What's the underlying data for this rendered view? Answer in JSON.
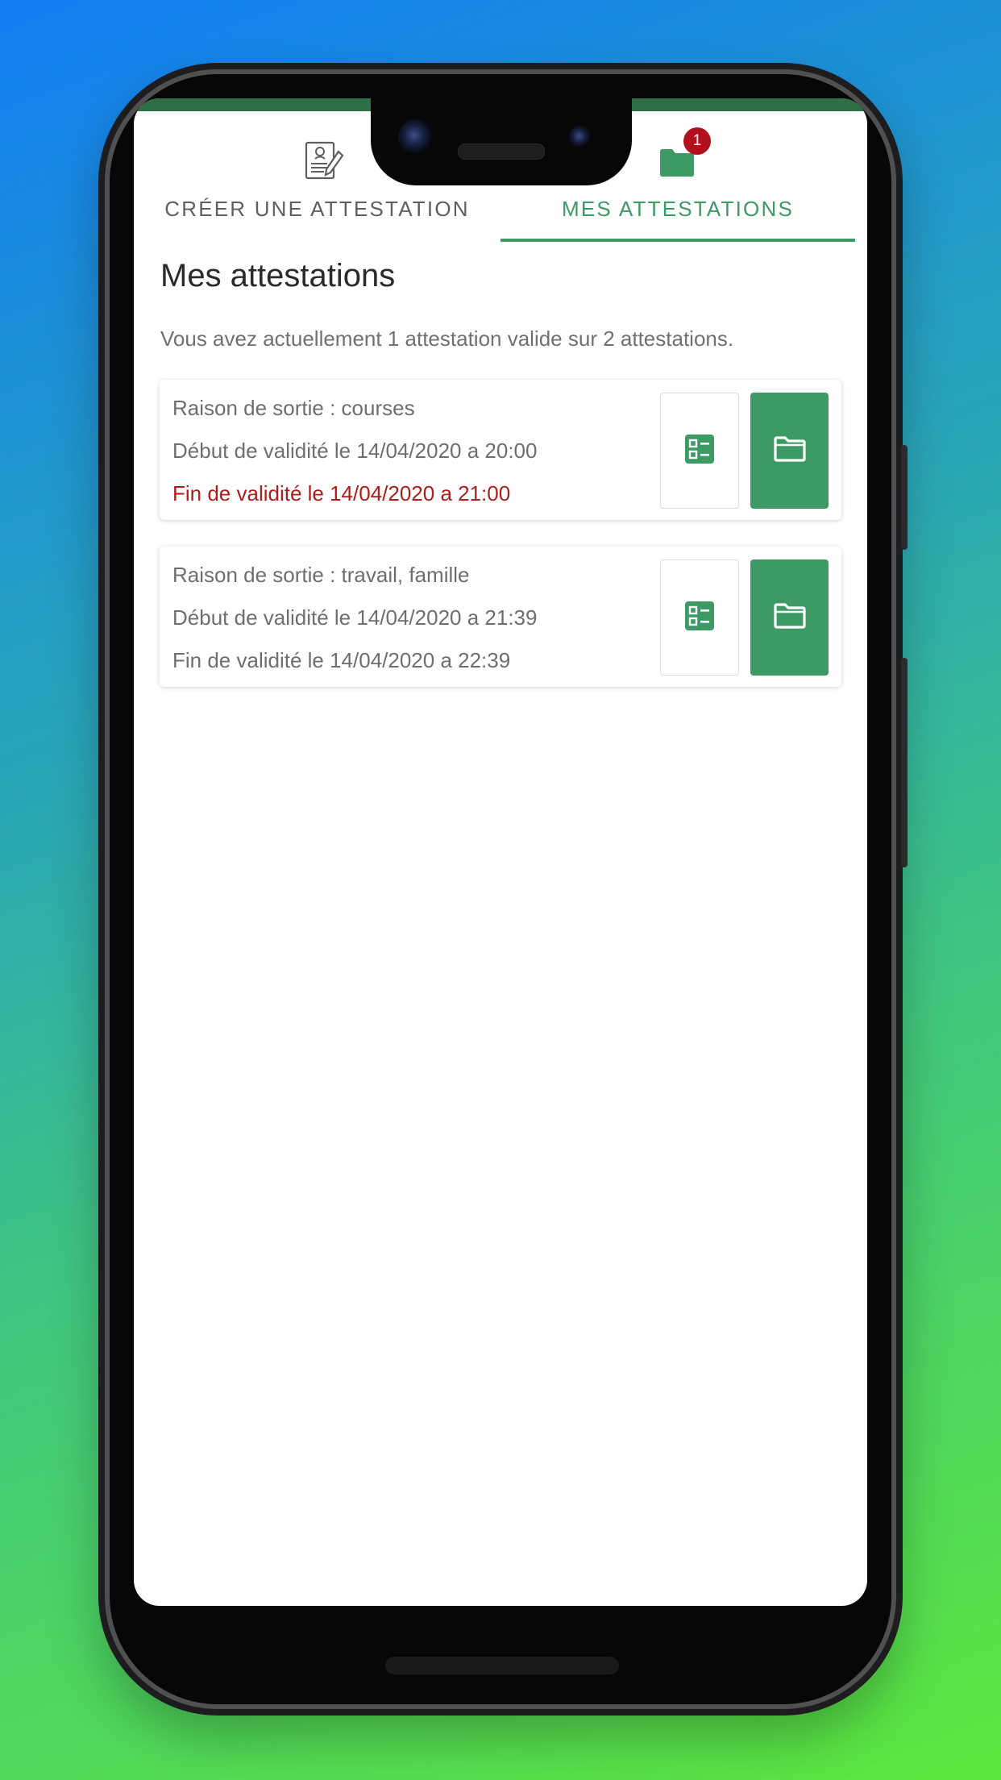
{
  "colors": {
    "accent": "#3d9a64",
    "badge": "#b3101e",
    "expired_text": "#b01c1c",
    "inactive_tab": "#5f5f5f"
  },
  "tabs": [
    {
      "label": "CRÉER UNE ATTESTATION",
      "icon": "document-pen-icon",
      "active": false
    },
    {
      "label": "MES ATTESTATIONS",
      "icon": "folder-icon",
      "active": true,
      "badge": "1"
    }
  ],
  "page": {
    "title": "Mes attestations",
    "summary": "Vous avez actuellement 1 attestation valide sur 2 attestations."
  },
  "attestations": [
    {
      "reason": "Raison de sortie : courses",
      "start": "Début de validité le 14/04/2020 a 20:00",
      "end": "Fin de validité le 14/04/2020 a 21:00",
      "expired": true,
      "actions": [
        "qr-code-icon",
        "folder-icon"
      ]
    },
    {
      "reason": "Raison de sortie : travail, famille",
      "start": "Début de validité le 14/04/2020 a 21:39",
      "end": "Fin de validité le 14/04/2020 a 22:39",
      "expired": false,
      "actions": [
        "qr-code-icon",
        "folder-icon"
      ]
    }
  ]
}
